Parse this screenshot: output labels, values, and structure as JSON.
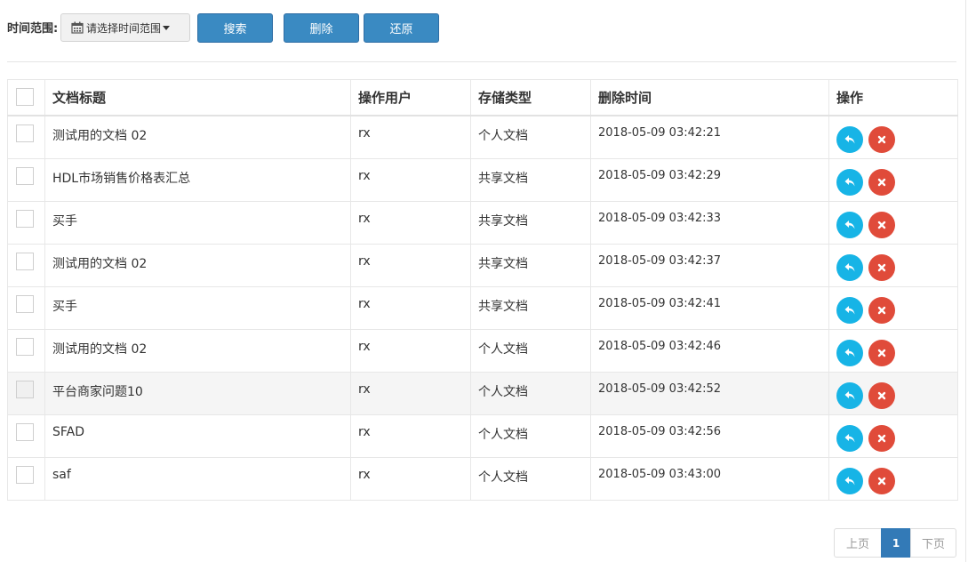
{
  "filter": {
    "label": "时间范围:",
    "picker_text": "请选择时间范围",
    "picker_icon": "calendar-icon"
  },
  "buttons": {
    "search": "搜索",
    "delete": "删除",
    "restore": "还原"
  },
  "table": {
    "columns": [
      "文档标题",
      "操作用户",
      "存储类型",
      "删除时间",
      "操作"
    ],
    "rows": [
      {
        "title": "测试用的文档 02",
        "user": "rx",
        "type": "个人文档",
        "time": "2018-05-09 03:42:21"
      },
      {
        "title": "HDL市场销售价格表汇总",
        "user": "rx",
        "type": "共享文档",
        "time": "2018-05-09 03:42:29"
      },
      {
        "title": "买手",
        "user": "rx",
        "type": "共享文档",
        "time": "2018-05-09 03:42:33"
      },
      {
        "title": "测试用的文档 02",
        "user": "rx",
        "type": "共享文档",
        "time": "2018-05-09 03:42:37"
      },
      {
        "title": "买手",
        "user": "rx",
        "type": "共享文档",
        "time": "2018-05-09 03:42:41"
      },
      {
        "title": "测试用的文档 02",
        "user": "rx",
        "type": "个人文档",
        "time": "2018-05-09 03:42:46"
      },
      {
        "title": "平台商家问题10",
        "user": "rx",
        "type": "个人文档",
        "time": "2018-05-09 03:42:52"
      },
      {
        "title": "SFAD",
        "user": "rx",
        "type": "个人文档",
        "time": "2018-05-09 03:42:56"
      },
      {
        "title": "saf",
        "user": "rx",
        "type": "个人文档",
        "time": "2018-05-09 03:43:00"
      }
    ],
    "row_actions": [
      "undo-icon",
      "close-icon"
    ],
    "highlighted_row_index": 6
  },
  "pagination": {
    "prev": "上页",
    "current": "1",
    "next": "下页"
  },
  "colors": {
    "primary_button": "#3a8ac2",
    "restore_action": "#17b4e6",
    "delete_action": "#e04b3a",
    "active_page": "#337ab7"
  }
}
